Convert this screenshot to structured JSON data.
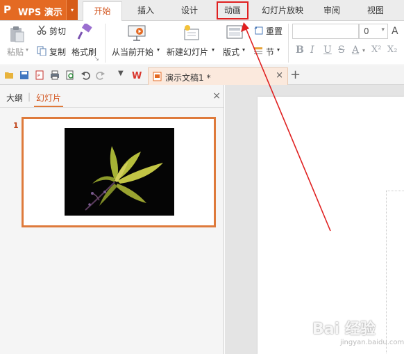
{
  "app": {
    "logo": "P",
    "name": "WPS 演示",
    "menu_arrow": "▾"
  },
  "tabs": [
    {
      "label": "开始",
      "active": true
    },
    {
      "label": "插入"
    },
    {
      "label": "设计"
    },
    {
      "label": "动画",
      "highlighted": true
    },
    {
      "label": "幻灯片放映"
    },
    {
      "label": "审阅"
    },
    {
      "label": "视图"
    }
  ],
  "ribbon": {
    "paste": "粘贴",
    "cut": "剪切",
    "copy": "复制",
    "format_painter": "格式刷",
    "from_current": "从当前开始",
    "new_slide": "新建幻灯片",
    "layout": "版式",
    "reset": "重置",
    "section": "节",
    "font_size_value": "0",
    "font_grow": "A",
    "bold": "B",
    "italic": "I",
    "underline": "U",
    "strike": "S",
    "font_color": "A",
    "superscript": "X²",
    "subscript": "X₂"
  },
  "document": {
    "tab_title": "演示文稿1 *",
    "close": "×",
    "new_tab": "+"
  },
  "leftpane": {
    "tab_outline": "大纲",
    "tab_slides": "幻灯片",
    "close": "×",
    "slide_number": "1"
  },
  "watermark": {
    "main": "Bai 经验",
    "sub": "jingyan.baidu.com"
  },
  "colors": {
    "accent": "#e46a23",
    "active_tab_text": "#d2541d",
    "highlight_box": "#e02020",
    "thumbnail_border": "#de7a3b"
  }
}
